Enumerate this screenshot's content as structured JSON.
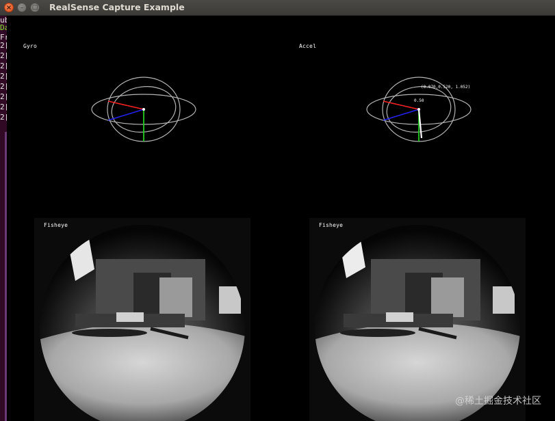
{
  "window": {
    "title": "RealSense Capture Example",
    "buttons": {
      "close": "×",
      "minimize": "–",
      "maximize": "□"
    }
  },
  "terminal": {
    "lines": [
      "ub",
      "Da",
      "",
      "Fr",
      "2[",
      "2[",
      "2[",
      "2[",
      "2[",
      "2[",
      "2[",
      "2["
    ]
  },
  "panels": {
    "gyro": {
      "label": "Gyro"
    },
    "accel": {
      "label": "Accel",
      "vector_text": "(0.070,0.520, 1.052)",
      "magnitude_text": "0.50"
    },
    "fisheye_left": {
      "label": "Fisheye"
    },
    "fisheye_right": {
      "label": "Fisheye"
    }
  },
  "axis_colors": {
    "x": "#ff2222",
    "y": "#22cc22",
    "z": "#2222ee",
    "rings": "#b4b4b4"
  },
  "watermark": "@稀土掘金技术社区"
}
